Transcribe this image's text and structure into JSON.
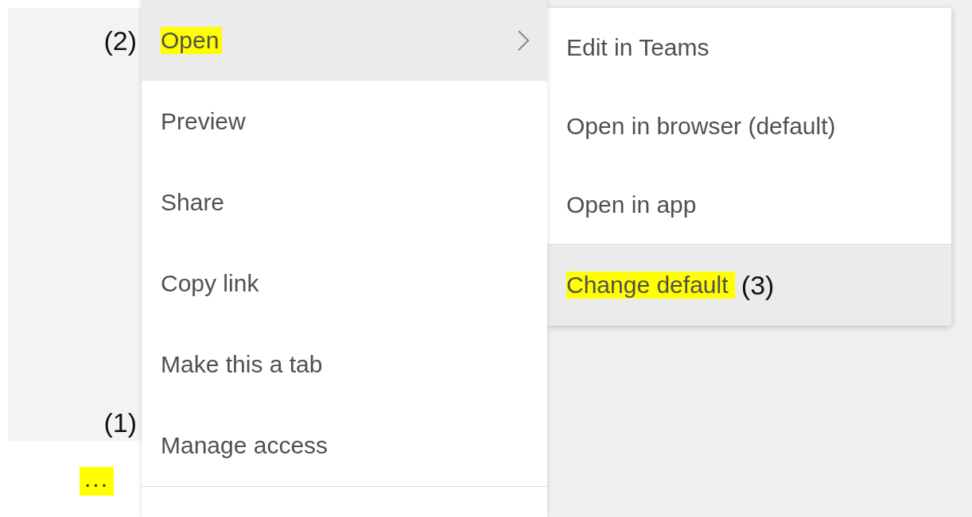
{
  "more_button": {
    "label": "...",
    "highlighted": true,
    "annotation": "(1)"
  },
  "menu": {
    "items": [
      {
        "label": "Open",
        "has_submenu": true,
        "hovered": true,
        "highlighted": true,
        "annotation": "(2)"
      },
      {
        "label": "Preview",
        "has_submenu": false,
        "hovered": false,
        "highlighted": false
      },
      {
        "label": "Share",
        "has_submenu": false,
        "hovered": false,
        "highlighted": false
      },
      {
        "label": "Copy link",
        "has_submenu": false,
        "hovered": false,
        "highlighted": false
      },
      {
        "label": "Make this a tab",
        "has_submenu": false,
        "hovered": false,
        "highlighted": false
      },
      {
        "label": "Manage access",
        "has_submenu": false,
        "hovered": false,
        "highlighted": false
      }
    ]
  },
  "submenu": {
    "items": [
      {
        "label": "Edit in Teams",
        "hovered": false,
        "highlighted": false,
        "separator_before": false
      },
      {
        "label": "Open in browser (default)",
        "hovered": false,
        "highlighted": false,
        "separator_before": false
      },
      {
        "label": "Open in app",
        "hovered": false,
        "highlighted": false,
        "separator_before": false
      },
      {
        "label": "Change default",
        "hovered": true,
        "highlighted": true,
        "separator_before": true,
        "annotation": "(3)"
      }
    ]
  }
}
